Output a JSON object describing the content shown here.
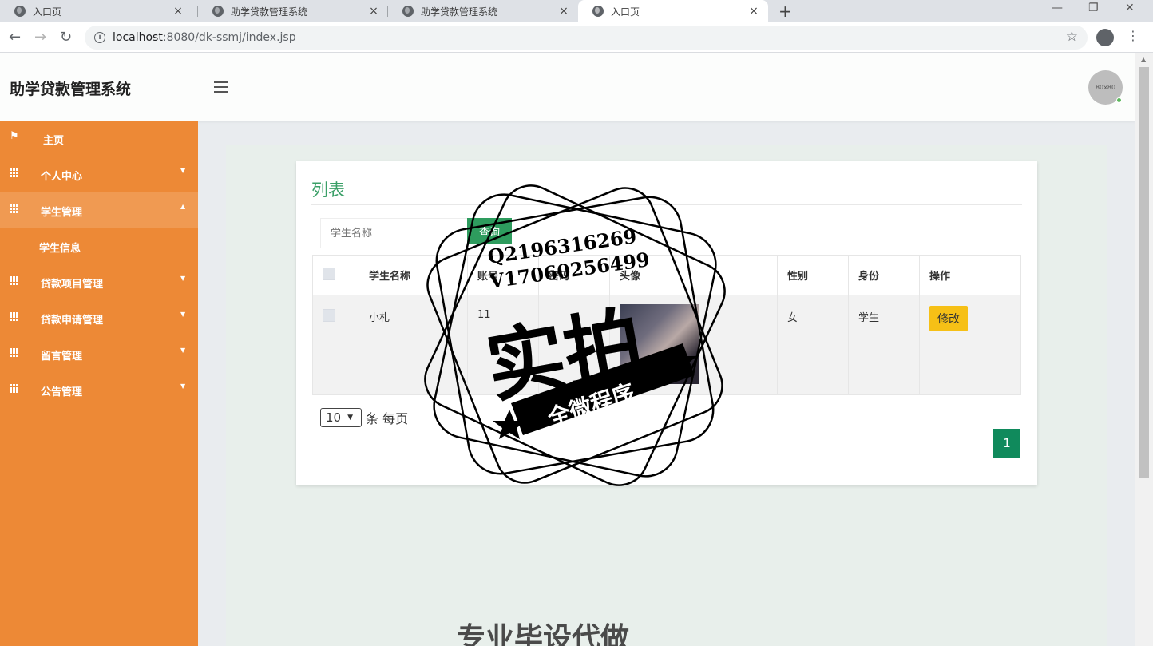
{
  "browser": {
    "tabs": [
      {
        "label": "入口页",
        "active": false
      },
      {
        "label": "助学贷款管理系统",
        "active": false
      },
      {
        "label": "助学贷款管理系统",
        "active": false
      },
      {
        "label": "入口页",
        "active": true
      }
    ],
    "new_tab": "+",
    "url_host": "localhost",
    "url_rest": ":8080/dk-ssmj/index.jsp"
  },
  "header": {
    "brand": "助学贷款管理系统",
    "avatar_text": "80x80"
  },
  "sidebar": {
    "items": [
      {
        "label": "主页",
        "icon": "flag-icon"
      },
      {
        "label": "个人中心",
        "icon": "grid-icon"
      },
      {
        "label": "学生管理",
        "icon": "grid-icon",
        "expanded": true
      },
      {
        "label": "贷款项目管理",
        "icon": "grid-icon"
      },
      {
        "label": "贷款申请管理",
        "icon": "grid-icon"
      },
      {
        "label": "留言管理",
        "icon": "grid-icon"
      },
      {
        "label": "公告管理",
        "icon": "grid-icon"
      }
    ],
    "sub_items": [
      {
        "label": "学生信息"
      }
    ]
  },
  "card": {
    "title": "列表",
    "search_placeholder": "学生名称",
    "search_button": "查询",
    "columns": [
      "学生名称",
      "账号",
      "密码",
      "头像",
      "性别",
      "身份",
      "操作"
    ],
    "rows": [
      {
        "name": "小札",
        "account": "11",
        "password": "",
        "gender": "女",
        "role": "学生",
        "action": "修改"
      }
    ],
    "page_size": "10",
    "page_size_suffix": "条 每页",
    "current_page": "1"
  },
  "overlay": {
    "contact_q": "Q2196316269",
    "contact_v": "V17060256499",
    "big": "实拍",
    "ribbon": "全微程序",
    "bottom": "专业毕设代做"
  },
  "colors": {
    "sidebar": "#ed8936",
    "accent_green": "#2e9c5e",
    "pager": "#108a5c",
    "edit_button": "#f6c016"
  }
}
